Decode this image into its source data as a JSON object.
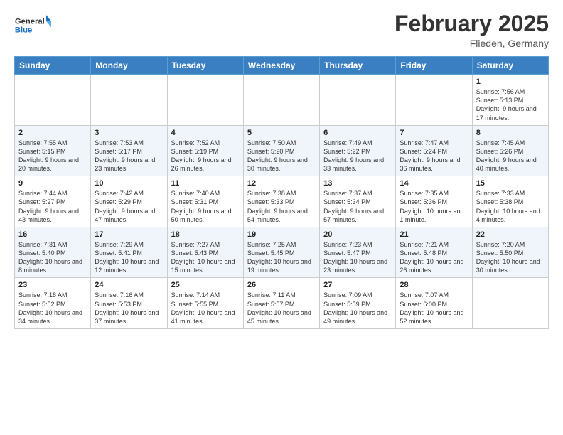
{
  "header": {
    "logo_general": "General",
    "logo_blue": "Blue",
    "month_year": "February 2025",
    "location": "Flieden, Germany"
  },
  "weekdays": [
    "Sunday",
    "Monday",
    "Tuesday",
    "Wednesday",
    "Thursday",
    "Friday",
    "Saturday"
  ],
  "weeks": [
    [
      {
        "day": "",
        "info": ""
      },
      {
        "day": "",
        "info": ""
      },
      {
        "day": "",
        "info": ""
      },
      {
        "day": "",
        "info": ""
      },
      {
        "day": "",
        "info": ""
      },
      {
        "day": "",
        "info": ""
      },
      {
        "day": "1",
        "info": "Sunrise: 7:56 AM\nSunset: 5:13 PM\nDaylight: 9 hours and 17 minutes."
      }
    ],
    [
      {
        "day": "2",
        "info": "Sunrise: 7:55 AM\nSunset: 5:15 PM\nDaylight: 9 hours and 20 minutes."
      },
      {
        "day": "3",
        "info": "Sunrise: 7:53 AM\nSunset: 5:17 PM\nDaylight: 9 hours and 23 minutes."
      },
      {
        "day": "4",
        "info": "Sunrise: 7:52 AM\nSunset: 5:19 PM\nDaylight: 9 hours and 26 minutes."
      },
      {
        "day": "5",
        "info": "Sunrise: 7:50 AM\nSunset: 5:20 PM\nDaylight: 9 hours and 30 minutes."
      },
      {
        "day": "6",
        "info": "Sunrise: 7:49 AM\nSunset: 5:22 PM\nDaylight: 9 hours and 33 minutes."
      },
      {
        "day": "7",
        "info": "Sunrise: 7:47 AM\nSunset: 5:24 PM\nDaylight: 9 hours and 36 minutes."
      },
      {
        "day": "8",
        "info": "Sunrise: 7:45 AM\nSunset: 5:26 PM\nDaylight: 9 hours and 40 minutes."
      }
    ],
    [
      {
        "day": "9",
        "info": "Sunrise: 7:44 AM\nSunset: 5:27 PM\nDaylight: 9 hours and 43 minutes."
      },
      {
        "day": "10",
        "info": "Sunrise: 7:42 AM\nSunset: 5:29 PM\nDaylight: 9 hours and 47 minutes."
      },
      {
        "day": "11",
        "info": "Sunrise: 7:40 AM\nSunset: 5:31 PM\nDaylight: 9 hours and 50 minutes."
      },
      {
        "day": "12",
        "info": "Sunrise: 7:38 AM\nSunset: 5:33 PM\nDaylight: 9 hours and 54 minutes."
      },
      {
        "day": "13",
        "info": "Sunrise: 7:37 AM\nSunset: 5:34 PM\nDaylight: 9 hours and 57 minutes."
      },
      {
        "day": "14",
        "info": "Sunrise: 7:35 AM\nSunset: 5:36 PM\nDaylight: 10 hours and 1 minute."
      },
      {
        "day": "15",
        "info": "Sunrise: 7:33 AM\nSunset: 5:38 PM\nDaylight: 10 hours and 4 minutes."
      }
    ],
    [
      {
        "day": "16",
        "info": "Sunrise: 7:31 AM\nSunset: 5:40 PM\nDaylight: 10 hours and 8 minutes."
      },
      {
        "day": "17",
        "info": "Sunrise: 7:29 AM\nSunset: 5:41 PM\nDaylight: 10 hours and 12 minutes."
      },
      {
        "day": "18",
        "info": "Sunrise: 7:27 AM\nSunset: 5:43 PM\nDaylight: 10 hours and 15 minutes."
      },
      {
        "day": "19",
        "info": "Sunrise: 7:25 AM\nSunset: 5:45 PM\nDaylight: 10 hours and 19 minutes."
      },
      {
        "day": "20",
        "info": "Sunrise: 7:23 AM\nSunset: 5:47 PM\nDaylight: 10 hours and 23 minutes."
      },
      {
        "day": "21",
        "info": "Sunrise: 7:21 AM\nSunset: 5:48 PM\nDaylight: 10 hours and 26 minutes."
      },
      {
        "day": "22",
        "info": "Sunrise: 7:20 AM\nSunset: 5:50 PM\nDaylight: 10 hours and 30 minutes."
      }
    ],
    [
      {
        "day": "23",
        "info": "Sunrise: 7:18 AM\nSunset: 5:52 PM\nDaylight: 10 hours and 34 minutes."
      },
      {
        "day": "24",
        "info": "Sunrise: 7:16 AM\nSunset: 5:53 PM\nDaylight: 10 hours and 37 minutes."
      },
      {
        "day": "25",
        "info": "Sunrise: 7:14 AM\nSunset: 5:55 PM\nDaylight: 10 hours and 41 minutes."
      },
      {
        "day": "26",
        "info": "Sunrise: 7:11 AM\nSunset: 5:57 PM\nDaylight: 10 hours and 45 minutes."
      },
      {
        "day": "27",
        "info": "Sunrise: 7:09 AM\nSunset: 5:59 PM\nDaylight: 10 hours and 49 minutes."
      },
      {
        "day": "28",
        "info": "Sunrise: 7:07 AM\nSunset: 6:00 PM\nDaylight: 10 hours and 52 minutes."
      },
      {
        "day": "",
        "info": ""
      }
    ]
  ]
}
